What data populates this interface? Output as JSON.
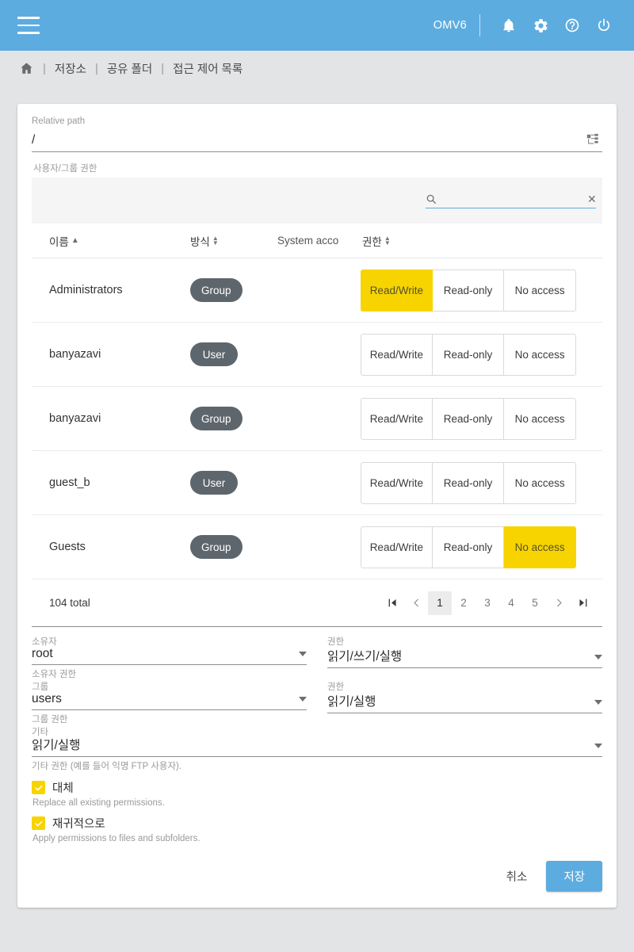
{
  "appbar": {
    "menu_icon": "hamburger-menu-icon",
    "brand": "OMV6",
    "icons": [
      "bell-icon",
      "gear-icon",
      "help-icon",
      "power-icon"
    ]
  },
  "breadcrumb": {
    "home_icon": "home-icon",
    "separator": "|",
    "items": [
      "저장소",
      "공유 폴더",
      "접근 제어 목록"
    ]
  },
  "relative_path": {
    "label": "Relative path",
    "value": "/",
    "tree_icon": "tree-view-icon"
  },
  "acl_section": {
    "label": "사용자/그룹 권한",
    "search": {
      "icon": "search-icon",
      "value": "",
      "placeholder": "",
      "clear_icon": "close-icon"
    }
  },
  "table": {
    "columns": [
      {
        "label": "이름",
        "sort": "asc"
      },
      {
        "label": "방식",
        "sort": "none"
      },
      {
        "label": "System acco",
        "sort": "none"
      },
      {
        "label": "권한",
        "sort": "none"
      }
    ],
    "permission_options": [
      "Read/Write",
      "Read-only",
      "No access"
    ],
    "rows": [
      {
        "name": "Administrators",
        "type": "Group",
        "system_account": "",
        "permission": "Read/Write"
      },
      {
        "name": "banyazavi",
        "type": "User",
        "system_account": "",
        "permission": ""
      },
      {
        "name": "banyazavi",
        "type": "Group",
        "system_account": "",
        "permission": ""
      },
      {
        "name": "guest_b",
        "type": "User",
        "system_account": "",
        "permission": ""
      },
      {
        "name": "Guests",
        "type": "Group",
        "system_account": "",
        "permission": "No access"
      }
    ]
  },
  "pagination": {
    "total": "104 total",
    "first_icon": "first-page-icon",
    "prev_icon": "chevron-left-icon",
    "pages": [
      "1",
      "2",
      "3",
      "4",
      "5"
    ],
    "current": "1",
    "next_icon": "chevron-right-icon",
    "last_icon": "last-page-icon"
  },
  "form": {
    "owner": {
      "label": "소유자",
      "value": "root",
      "hint": "소유자 권한"
    },
    "owner_perm": {
      "label": "권한",
      "value": "읽기/쓰기/실행"
    },
    "group": {
      "label": "그룹",
      "value": "users",
      "hint": "그룹 권한"
    },
    "group_perm": {
      "label": "권한",
      "value": "읽기/실행"
    },
    "other": {
      "label": "기타",
      "value": "읽기/실행",
      "hint": "기타 권한 (예를 들어 익명 FTP 사용자)."
    },
    "replace": {
      "label": "대체",
      "desc": "Replace all existing permissions.",
      "checked": true
    },
    "recursive": {
      "label": "재귀적으로",
      "desc": "Apply permissions to files and subfolders.",
      "checked": true
    }
  },
  "actions": {
    "cancel": "취소",
    "save": "저장"
  },
  "colors": {
    "appbar": "#5dace0",
    "accent_yellow": "#f7d400",
    "chip": "#5e666d",
    "page_bg": "#e3e4e6"
  }
}
